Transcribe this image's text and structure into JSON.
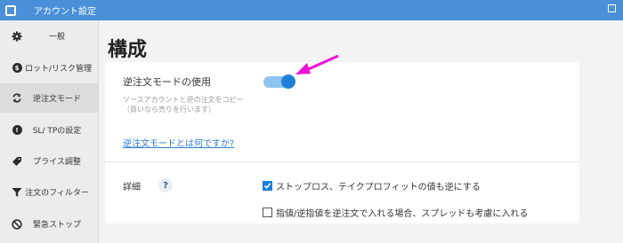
{
  "window": {
    "title": "アカウント設定"
  },
  "sidebar": {
    "items": [
      {
        "label": "一般",
        "icon": "gear-icon"
      },
      {
        "label": "ロット/リスク管理",
        "icon": "dollar-icon"
      },
      {
        "label": "逆注文モード",
        "icon": "reverse-sync-icon",
        "active": true
      },
      {
        "label": "SL/ TPの設定",
        "icon": "exclamation-icon"
      },
      {
        "label": "プライス調整",
        "icon": "tag-icon"
      },
      {
        "label": "注文のフィルター",
        "icon": "filter-icon"
      },
      {
        "label": "緊急ストップ",
        "icon": "stop-icon"
      }
    ]
  },
  "main": {
    "title": "構成",
    "reverse_mode": {
      "label": "逆注文モードの使用",
      "description": "ソースアカウントと逆の注文をコピー（買いなら売りを行います）",
      "toggle_on": true,
      "help_link": "逆注文モードとは何ですか?"
    },
    "details": {
      "label": "詳細",
      "help_icon": "?",
      "options": [
        {
          "label": "ストップロス、テイクプロフィットの値も逆にする",
          "checked": true
        },
        {
          "label": "指値/逆指値を逆注文で入れる場合、スプレッドも考慮に入れる",
          "checked": false
        }
      ]
    }
  },
  "colors": {
    "accent": "#1f7fd8",
    "titlebar": "#4a90d9",
    "annotation_arrow": "#ee10d6"
  }
}
